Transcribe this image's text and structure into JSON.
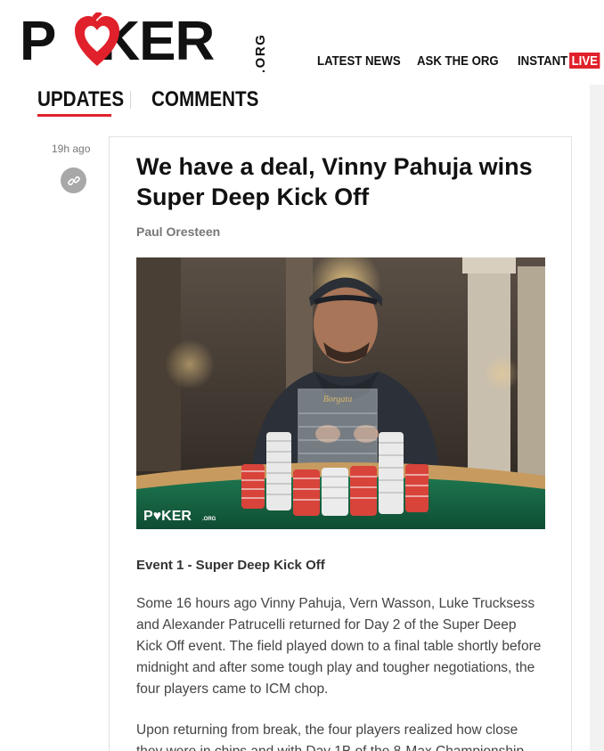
{
  "header": {
    "logo": {
      "text_left": "P",
      "text_right": "KER",
      "suffix": ".ORG",
      "heart_color": "#e0212b"
    },
    "nav": {
      "latest_news": "LATEST NEWS",
      "ask_the_org": "ASK THE ORG",
      "instant": "INSTANT",
      "live": "LIVE"
    }
  },
  "tabs": {
    "updates": "UPDATES",
    "comments": "COMMENTS",
    "active": "UPDATES"
  },
  "post": {
    "time_ago": "19h ago",
    "link_icon": "link-icon",
    "title": "We have a deal, Vinny Pahuja wins Super Deep Kick Off",
    "author": "Paul Oresteen",
    "photo_watermark": "P♥KER",
    "photo_watermark_suffix": ".ORG",
    "trophy_label": "Borgata",
    "subhead": "Event 1 - Super Deep Kick Off",
    "paragraphs": [
      "Some 16 hours ago Vinny Pahuja, Vern Wasson, Luke Trucksess and Alexander Patrucelli returned for Day 2 of the Super Deep Kick Off event. The field played down to a final table shortly before midnight and after some tough play and tougher negotiations, the four players came to ICM chop.",
      "Upon returning from break, the four players realized how close they were in chips and with Day 1B of the 8-Max Championship"
    ]
  },
  "colors": {
    "brand_red": "#e0212b",
    "text_dark": "#111111",
    "text_muted": "#777777",
    "body_text": "#444444"
  }
}
